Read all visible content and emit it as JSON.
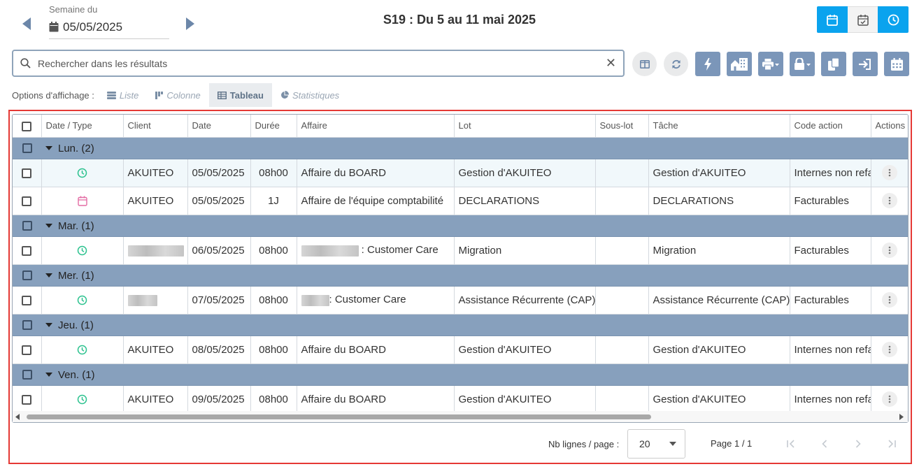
{
  "header": {
    "week_label": "Semaine du",
    "week_date": "05/05/2025",
    "title": "S19 : Du 5 au 11 mai 2025",
    "prev_icon": "triangle-left-icon",
    "next_icon": "triangle-right-icon",
    "view_modes": [
      "calendar-icon",
      "calendar-check-icon",
      "clock-icon"
    ],
    "accent": "#0aa3ee"
  },
  "search": {
    "placeholder": "Rechercher dans les résultats",
    "value": "",
    "clear": "✕"
  },
  "toolbar": {
    "buttons": [
      "columns-icon",
      "refresh-icon",
      "bolt-icon",
      "building-icon",
      "print-dropdown-icon",
      "lock-dropdown-icon",
      "copy-icon",
      "sign-in-icon",
      "calendar-grid-icon"
    ],
    "button_color": "#7b96b9"
  },
  "display_options": {
    "label": "Options d'affichage :",
    "items": [
      {
        "label": "Liste",
        "icon": "list-icon",
        "active": false
      },
      {
        "label": "Colonne",
        "icon": "columns-bar-icon",
        "active": false
      },
      {
        "label": "Tableau",
        "icon": "table-icon",
        "active": true
      },
      {
        "label": "Statistiques",
        "icon": "pie-chart-icon",
        "active": false
      }
    ]
  },
  "table": {
    "columns": [
      "Date / Type",
      "Client",
      "Date",
      "Durée",
      "Affaire",
      "Lot",
      "Sous-lot",
      "Tâche",
      "Code action",
      "Actions"
    ],
    "group_color": "#87a0bd",
    "groups": [
      {
        "label": "Lun. (2)",
        "rows": [
          {
            "type": "clock",
            "client": "AKUITEO",
            "date": "05/05/2025",
            "duree": "08h00",
            "affaire": "Affaire du BOARD",
            "lot": "Gestion d'AKUITEO",
            "sous_lot": "",
            "tache": "Gestion d'AKUITEO",
            "code": "Internes non refacturables"
          },
          {
            "type": "calendar",
            "client": "AKUITEO",
            "date": "05/05/2025",
            "duree": "1J",
            "affaire": "Affaire de l'équipe comptabilité",
            "lot": "DECLARATIONS",
            "sous_lot": "",
            "tache": "DECLARATIONS",
            "code": "Facturables"
          }
        ]
      },
      {
        "label": "Mar. (1)",
        "rows": [
          {
            "type": "clock",
            "client": "",
            "date": "06/05/2025",
            "duree": "08h00",
            "affaire": ": Customer Care",
            "lot": "Migration",
            "sous_lot": "",
            "tache": "Migration",
            "code": "Facturables"
          }
        ]
      },
      {
        "label": "Mer. (1)",
        "rows": [
          {
            "type": "clock",
            "client": "",
            "date": "07/05/2025",
            "duree": "08h00",
            "affaire": ": Customer Care",
            "lot": "Assistance Récurrente (CAP)",
            "sous_lot": "",
            "tache": "Assistance Récurrente (CAP)",
            "code": "Facturables"
          }
        ]
      },
      {
        "label": "Jeu. (1)",
        "rows": [
          {
            "type": "clock",
            "client": "AKUITEO",
            "date": "08/05/2025",
            "duree": "08h00",
            "affaire": "Affaire du BOARD",
            "lot": "Gestion d'AKUITEO",
            "sous_lot": "",
            "tache": "Gestion d'AKUITEO",
            "code": "Internes non refacturables"
          }
        ]
      },
      {
        "label": "Ven. (1)",
        "rows": [
          {
            "type": "clock",
            "client": "AKUITEO",
            "date": "09/05/2025",
            "duree": "08h00",
            "affaire": "Affaire du BOARD",
            "lot": "Gestion d'AKUITEO",
            "sous_lot": "",
            "tache": "Gestion d'AKUITEO",
            "code": "Internes non refacturables"
          }
        ]
      }
    ]
  },
  "pagination": {
    "lines_label": "Nb lignes / page :",
    "page_size": "20",
    "page_info": "Page 1 / 1",
    "nav_icons": [
      "first-page-icon",
      "prev-page-icon",
      "next-page-icon",
      "last-page-icon"
    ]
  }
}
